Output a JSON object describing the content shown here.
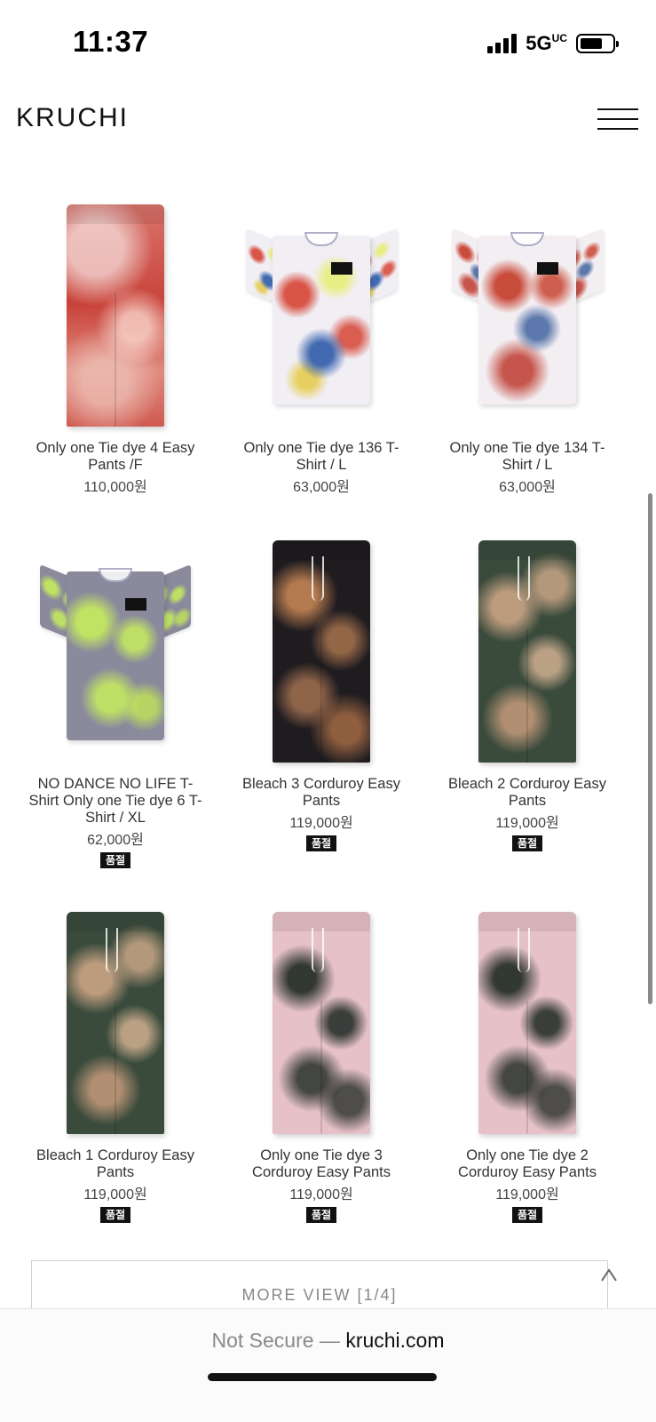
{
  "status_bar": {
    "time": "11:37",
    "network": "5G",
    "network_suffix": "UC",
    "signal_bars": 4,
    "battery_level": 0.7
  },
  "header": {
    "logo": "KRUCHI",
    "menu_icon": "hamburger-menu-icon"
  },
  "products": [
    {
      "name": "Only one Tie dye 4 Easy Pants /F",
      "price": "110,000원",
      "sold_out": false,
      "type": "pants",
      "pattern": "dye-red"
    },
    {
      "name": "Only one Tie dye 136 T-Shirt / L",
      "price": "63,000원",
      "sold_out": false,
      "type": "tshirt",
      "pattern": "dye-rainbow"
    },
    {
      "name": "Only one Tie dye 134 T-Shirt / L",
      "price": "63,000원",
      "sold_out": false,
      "type": "tshirt",
      "pattern": "dye-redblue"
    },
    {
      "name": "NO DANCE NO LIFE T-Shirt Only one Tie dye 6 T-Shirt / XL",
      "price": "62,000원",
      "sold_out": true,
      "type": "tshirt",
      "pattern": "dye-lime"
    },
    {
      "name": "Bleach 3 Corduroy Easy Pants",
      "price": "119,000원",
      "sold_out": true,
      "type": "pants",
      "pattern": "dye-black-tan"
    },
    {
      "name": "Bleach 2 Corduroy Easy Pants",
      "price": "119,000원",
      "sold_out": true,
      "type": "pants",
      "pattern": "dye-green-tan"
    },
    {
      "name": "Bleach 1 Corduroy Easy Pants",
      "price": "119,000원",
      "sold_out": true,
      "type": "pants",
      "pattern": "dye-green-tan"
    },
    {
      "name": "Only one Tie dye 3 Corduroy Easy Pants",
      "price": "119,000원",
      "sold_out": true,
      "type": "pants",
      "pattern": "dye-pink-black"
    },
    {
      "name": "Only one Tie dye 2 Corduroy Easy Pants",
      "price": "119,000원",
      "sold_out": true,
      "type": "pants",
      "pattern": "dye-pink-black"
    }
  ],
  "soldout_label": "품절",
  "more_view": {
    "label": "MORE VIEW [1/4]"
  },
  "browser": {
    "security_label": "Not Secure —",
    "domain": "kruchi.com"
  }
}
